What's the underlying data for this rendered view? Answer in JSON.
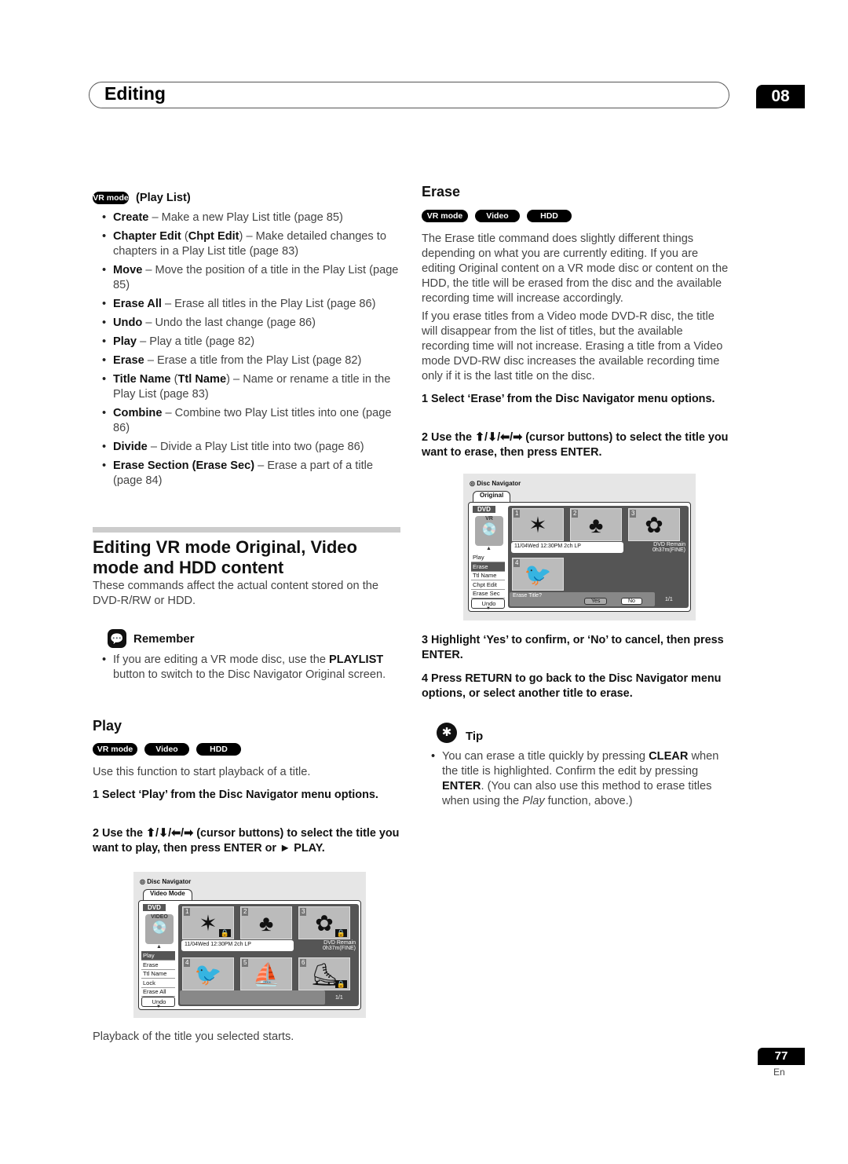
{
  "header": {
    "title": "Editing",
    "chapter": "08"
  },
  "badges": {
    "vr": "VR mode",
    "video": "Video mode",
    "hdd": "HDD"
  },
  "playlist": {
    "heading": "(Play List)",
    "items": [
      [
        {
          "b": "Create"
        },
        {
          "t": " – Make a new Play List title (page 85)"
        }
      ],
      [
        {
          "b": "Chapter Edit"
        },
        {
          "t": " ("
        },
        {
          "b": "Chpt Edit"
        },
        {
          "t": ") – Make detailed changes to chapters in a Play List title (page 83)"
        }
      ],
      [
        {
          "b": "Move"
        },
        {
          "t": " – Move the position of a title in the Play List (page 85)"
        }
      ],
      [
        {
          "b": "Erase All"
        },
        {
          "t": " – Erase all titles in the Play List (page 86)"
        }
      ],
      [
        {
          "b": "Undo"
        },
        {
          "t": " – Undo the last change (page 86)"
        }
      ],
      [
        {
          "b": "Play"
        },
        {
          "t": " – Play a title (page 82)"
        }
      ],
      [
        {
          "b": "Erase"
        },
        {
          "t": " – Erase a title from the Play List (page 82)"
        }
      ],
      [
        {
          "b": "Title Name"
        },
        {
          "t": " ("
        },
        {
          "b": "Ttl Name"
        },
        {
          "t": ") – Name or rename a title in the Play List (page 83)"
        }
      ],
      [
        {
          "b": "Combine"
        },
        {
          "t": " – Combine two Play List titles into one (page 86)"
        }
      ],
      [
        {
          "b": "Divide"
        },
        {
          "t": " – Divide a Play List title into two (page 86)"
        }
      ],
      [
        {
          "b": "Erase Section (Erase Sec)"
        },
        {
          "t": " – Erase a part of a title (page 84)"
        }
      ]
    ]
  },
  "section": {
    "title": "Editing VR mode Original, Video mode and HDD content",
    "intro": "These commands affect the actual content stored on the DVD-R/RW or HDD."
  },
  "remember": {
    "label": "Remember",
    "items": [
      [
        {
          "t": "If you are editing a VR mode disc, use the "
        },
        {
          "b": "PLAYLIST"
        },
        {
          "t": " button to switch to the Disc Navigator Original screen."
        }
      ]
    ]
  },
  "play": {
    "heading": "Play",
    "intro": "Use this function to start playback of a title.",
    "step1": "1   Select ‘Play’ from the Disc Navigator menu options.",
    "step2": "2   Use the ⬆/⬇/⬅/➡ (cursor buttons) to select the title you want to play, then press ENTER or ► PLAY.",
    "outro": "Playback of the title you selected starts."
  },
  "erase": {
    "heading": "Erase",
    "p1": "The Erase title command does slightly different things depending on what you are currently editing. If you are editing Original content on a VR mode disc or content on the HDD, the title will be erased from the disc and the available recording time will increase accordingly.",
    "p2": "If you erase titles from a Video mode DVD-R disc, the title will disappear from the list of titles, but the available recording time will not increase. Erasing a title from a Video mode DVD-RW disc increases the available recording time only if it is the last title on the disc.",
    "step1": "1   Select ‘Erase’ from the Disc Navigator menu options.",
    "step2": "2   Use the ⬆/⬇/⬅/➡ (cursor buttons) to select the title you want to erase, then press ENTER.",
    "step3": "3   Highlight ‘Yes’ to confirm, or ‘No’ to cancel, then press ENTER.",
    "step4": "4   Press RETURN to go back to the Disc Navigator menu options, or select another title to erase."
  },
  "tip": {
    "label": "Tip",
    "items": [
      [
        {
          "t": "You can erase a title quickly by pressing "
        },
        {
          "b": "CLEAR"
        },
        {
          "t": " when the title is highlighted. Confirm the edit by pressing "
        },
        {
          "b": "ENTER"
        },
        {
          "t": ". (You can also use this method to erase titles when using the "
        },
        {
          "i": "Play"
        },
        {
          "t": " function, above.)"
        }
      ]
    ]
  },
  "screen_erase": {
    "title": "Disc Navigator",
    "tab": "Original",
    "disc": "DVD",
    "disc_label": "VR",
    "menu": [
      "Play",
      "Erase",
      "Ttl Name",
      "Chpt Edit",
      "Erase Sec"
    ],
    "selected": "Erase",
    "undo": "Undo",
    "thumbs": [
      "1",
      "2",
      "3",
      "4"
    ],
    "info": "11/04Wed 12:30PM   2ch LP",
    "remain": "DVD Remain",
    "remain_time": "0h37m(FINE)",
    "prompt": "Erase Title?",
    "yes": "Yes",
    "no": "No",
    "page": "1/1"
  },
  "screen_play": {
    "title": "Disc Navigator",
    "tab": "Video Mode",
    "disc": "DVD",
    "disc_label": "VIDEO",
    "menu": [
      "Play",
      "Erase",
      "Ttl Name",
      "Lock",
      "Erase All"
    ],
    "selected": "Play",
    "undo": "Undo",
    "thumbs": [
      "1",
      "2",
      "3",
      "4",
      "5",
      "6"
    ],
    "locked": [
      "1",
      "3",
      "6"
    ],
    "info": "11/04Wed 12:30PM   2ch LP",
    "remain": "DVD Remain",
    "remain_time": "0h37m(FINE)",
    "page": "1/1"
  },
  "footer": {
    "page": "77",
    "lang": "En"
  }
}
